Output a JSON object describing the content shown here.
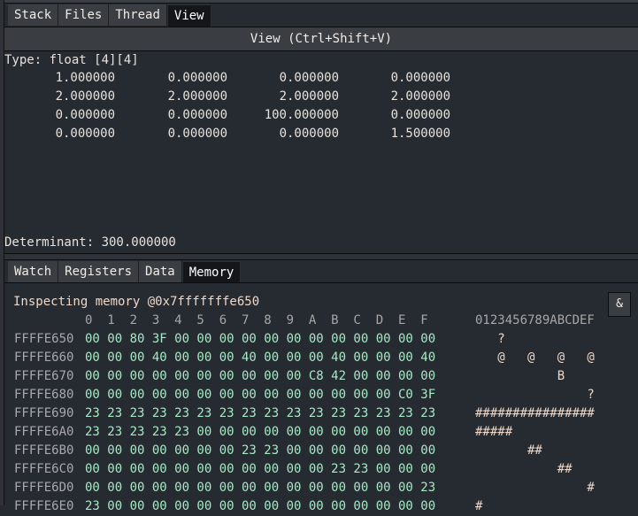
{
  "top_tabs": [
    {
      "label": "Stack",
      "active": false
    },
    {
      "label": "Files",
      "active": false
    },
    {
      "label": "Thread",
      "active": false
    },
    {
      "label": "View",
      "active": true
    }
  ],
  "view": {
    "header": "View (Ctrl+Shift+V)",
    "type_line": "Type: float [4][4]",
    "matrix": [
      [
        "1.000000",
        "0.000000",
        "0.000000",
        "0.000000"
      ],
      [
        "2.000000",
        "2.000000",
        "2.000000",
        "2.000000"
      ],
      [
        "0.000000",
        "0.000000",
        "100.000000",
        "0.000000"
      ],
      [
        "0.000000",
        "0.000000",
        "0.000000",
        "1.500000"
      ]
    ],
    "determinant": "Determinant: 300.000000"
  },
  "bottom_tabs": [
    {
      "label": "Watch",
      "active": false
    },
    {
      "label": "Registers",
      "active": false
    },
    {
      "label": "Data",
      "active": false
    },
    {
      "label": "Memory",
      "active": true
    }
  ],
  "memory": {
    "title": "Inspecting memory @0x7fffffffe650",
    "amp_button": "&",
    "column_header": "0  1  2  3  4  5  6  7  8  9  A  B  C  D  E  F",
    "ascii_header": "0123456789ABCDEF",
    "rows": [
      {
        "addr": "FFFFE650",
        "bytes": "00 00 80 3F 00 00 00 00 00 00 00 00 00 00 00 00",
        "ascii": "   ?            "
      },
      {
        "addr": "FFFFE660",
        "bytes": "00 00 00 40 00 00 00 40 00 00 00 40 00 00 00 40",
        "ascii": "   @   @   @   @"
      },
      {
        "addr": "FFFFE670",
        "bytes": "00 00 00 00 00 00 00 00 00 00 C8 42 00 00 00 00",
        "ascii": "           B    "
      },
      {
        "addr": "FFFFE680",
        "bytes": "00 00 00 00 00 00 00 00 00 00 00 00 00 00 C0 3F",
        "ascii": "               ?"
      },
      {
        "addr": "FFFFE690",
        "bytes": "23 23 23 23 23 23 23 23 23 23 23 23 23 23 23 23",
        "ascii": "################"
      },
      {
        "addr": "FFFFE6A0",
        "bytes": "23 23 23 23 23 00 00 00 00 00 00 00 00 00 00 00",
        "ascii": "#####           "
      },
      {
        "addr": "FFFFE6B0",
        "bytes": "00 00 00 00 00 00 00 23 23 00 00 00 00 00 00 00",
        "ascii": "       ##       "
      },
      {
        "addr": "FFFFE6C0",
        "bytes": "00 00 00 00 00 00 00 00 00 00 00 23 23 00 00 00",
        "ascii": "           ##   "
      },
      {
        "addr": "FFFFE6D0",
        "bytes": "00 00 00 00 00 00 00 00 00 00 00 00 00 00 00 23",
        "ascii": "               #"
      },
      {
        "addr": "FFFFE6E0",
        "bytes": "23 00 00 00 00 00 00 00 00 00 00 00 00 00 00 00",
        "ascii": "#               "
      }
    ]
  }
}
